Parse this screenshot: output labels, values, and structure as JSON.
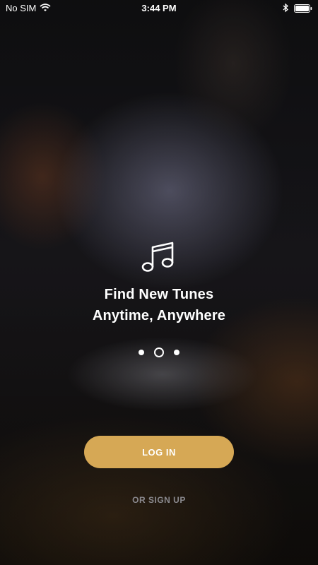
{
  "status_bar": {
    "carrier": "No SIM",
    "time": "3:44 PM"
  },
  "hero": {
    "icon": "music-note-icon",
    "title_line1": "Find New Tunes",
    "title_line2": "Anytime, Anywhere"
  },
  "pagination": {
    "pages": 3,
    "active_index": 1
  },
  "actions": {
    "login_label": "LOG IN",
    "signup_label": "OR SIGN UP"
  },
  "colors": {
    "accent": "#d6a855",
    "secondary_text": "#8b8a8f"
  }
}
